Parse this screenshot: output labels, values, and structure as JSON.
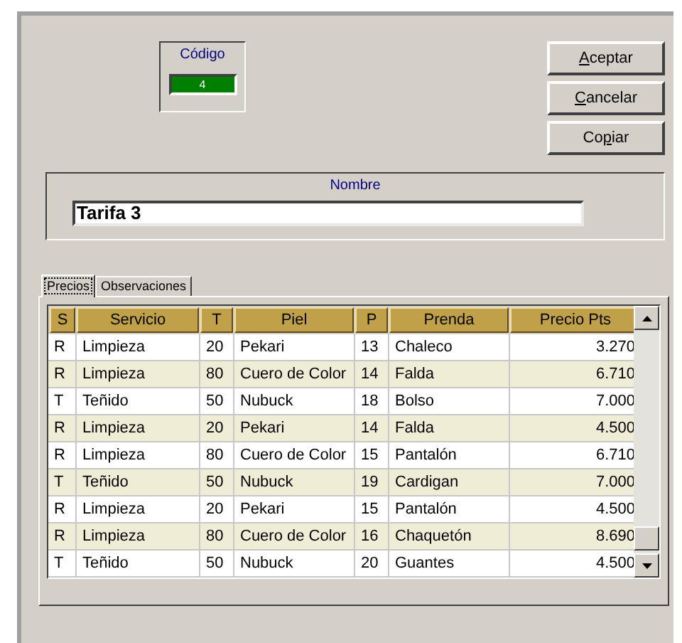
{
  "codigo": {
    "label": "Código",
    "value": "4"
  },
  "buttons": [
    {
      "label": "Aceptar"
    },
    {
      "label": "Cancelar"
    },
    {
      "label": "Copiar"
    }
  ],
  "nombre": {
    "label": "Nombre",
    "value": "Tarifa 3"
  },
  "tabs": [
    {
      "label": "Precios",
      "selected": true
    },
    {
      "label": "Observaciones",
      "selected": false
    }
  ],
  "table": {
    "columns": [
      "S",
      "Servicio",
      "T",
      "Piel",
      "P",
      "Prenda",
      "Precio Pts"
    ],
    "rows": [
      [
        "R",
        "Limpieza",
        "20",
        "Pekari",
        "13",
        "Chaleco",
        "3.270"
      ],
      [
        "R",
        "Limpieza",
        "80",
        "Cuero de Color",
        "14",
        "Falda",
        "6.710"
      ],
      [
        "T",
        "Teñido",
        "50",
        "Nubuck",
        "18",
        "Bolso",
        "7.000"
      ],
      [
        "R",
        "Limpieza",
        "20",
        "Pekari",
        "14",
        "Falda",
        "4.500"
      ],
      [
        "R",
        "Limpieza",
        "80",
        "Cuero de Color",
        "15",
        "Pantalón",
        "6.710"
      ],
      [
        "T",
        "Teñido",
        "50",
        "Nubuck",
        "19",
        "Cardigan",
        "7.000"
      ],
      [
        "R",
        "Limpieza",
        "20",
        "Pekari",
        "15",
        "Pantalón",
        "4.500"
      ],
      [
        "R",
        "Limpieza",
        "80",
        "Cuero de Color",
        "16",
        "Chaquetón",
        "8.690"
      ],
      [
        "T",
        "Teñido",
        "50",
        "Nubuck",
        "20",
        "Guantes",
        "4.500"
      ]
    ]
  }
}
